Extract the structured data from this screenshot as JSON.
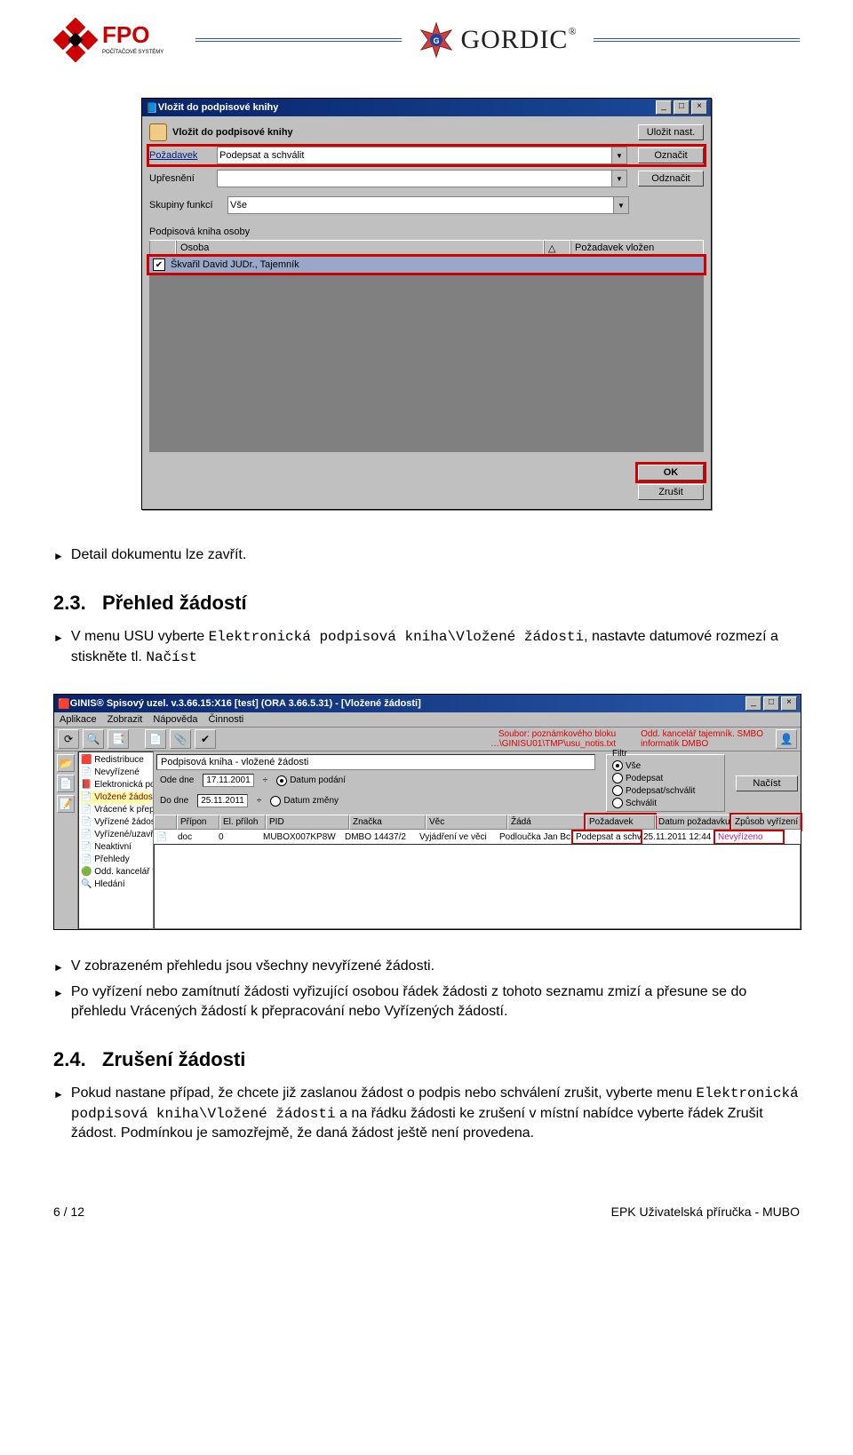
{
  "header": {
    "fpo_sub": "POČÍTAČOVÉ SYSTÉMY",
    "gordic": "GORDIC",
    "reg": "®"
  },
  "dialog1": {
    "title": "Vložit do podpisové knihy",
    "heading": "Vložit do podpisové knihy",
    "btn_save": "Uložit nast.",
    "btn_mark": "Označit",
    "btn_unmark": "Odznačit",
    "lbl_request": "Požadavek",
    "val_request": "Podepsat a schválit",
    "lbl_refine": "Upřesnění",
    "lbl_groups": "Skupiny funkcí",
    "val_groups": "Vše",
    "lbl_book": "Podpisová kniha osoby",
    "col_osoba": "Osoba",
    "col_req": "Požadavek vložen",
    "row_person": "Škvařil David JUDr., Tajemník",
    "btn_ok": "OK",
    "btn_cancel": "Zrušit"
  },
  "text1": "Detail dokumentu lze zavřít.",
  "sec23": {
    "num": "2.3.",
    "title": "Přehled žádostí",
    "p1a": "V menu USU vyberte ",
    "p1b": "Elektronická podpisová kniha\\Vložené žádosti",
    "p1c": ", nastavte datumové rozmezí a stiskněte tl. ",
    "p1d": "Načíst"
  },
  "app": {
    "title": "GINIS® Spisový uzel. v.3.66.15:X16 [test] (ORA 3.66.5.31) - [Vložené žádosti]",
    "menu": [
      "Aplikace",
      "Zobrazit",
      "Nápověda",
      "Činnosti"
    ],
    "red_top1": "Soubor: poznámkového bloku",
    "red_top2": "…\\GINISU01\\TMP\\usu_notis.txt",
    "red_right1": "Odd. kancelář tajemník. SMBO",
    "red_right2": "informatik              DMBO",
    "tree": {
      "i0": "🟥 Redistribuce",
      "i1": "📄 Nevyřízené",
      "i2": "📕 Elektronická podpisová kniha",
      "i3": "   📄 Vložené žádosti",
      "i4": "   📄 Vrácené k přepracování",
      "i5": "   📄 Vyřízené žádosti",
      "i6": "📄 Vyřízené/uzavřené",
      "i7": "📄 Neaktivní",
      "i8": "📄 Přehledy",
      "i9": "🟢 Odd. kancelář tajemníka",
      "i10": "🔍 Hledání"
    },
    "pane_title": "Podpisová kniha - vložené žádosti",
    "lbl_from": "Ode dne",
    "val_from": "17.11.2001",
    "lbl_to": "Do dne",
    "val_to": "25.11.2011",
    "r_podani": "Datum podání",
    "r_zmeny": "Datum změny",
    "grp_filter": "Filtr",
    "r_vse": "Vše",
    "r_podepsat": "Podepsat",
    "r_podschval": "Podepsat/schválit",
    "r_schvalit": "Schválit",
    "btn_load": "Načíst",
    "cols": [
      "Přípon",
      "El. příloh",
      "PID",
      "Značka",
      "Věc",
      "Žádá",
      "Požadavek",
      "Datum požadavku",
      "Způsob vyřízení"
    ],
    "row": {
      "pripon": "doc",
      "el": "0",
      "pid": "MUBOX007KP8W",
      "znacka": "DMBO  14437/2",
      "vec": "Vyjádření ve věci",
      "zada": "Podloučka Jan Bc..",
      "poz": "Podepsat a schválit",
      "datum": "25.11.2011 12:44",
      "vyr": "Nevyřízeno"
    }
  },
  "after_app": {
    "b1": "V zobrazeném přehledu jsou všechny nevyřízené žádosti.",
    "b2": "Po vyřízení nebo zamítnutí žádosti vyřizující osobou řádek žádosti z tohoto seznamu zmizí a přesune se do přehledu Vrácených žádostí k přepracování nebo Vyřízených žádostí."
  },
  "sec24": {
    "num": "2.4.",
    "title": "Zrušení žádosti",
    "p1a": "Pokud nastane případ, že chcete již zaslanou žádost o podpis nebo schválení zrušit, vyberte menu ",
    "p1b": "Elektronická podpisová kniha\\Vložené žádosti",
    "p1c": " a na řádku žádosti ke zrušení v místní nabídce vyberte řádek Zrušit žádost. Podmínkou je samozřejmě, že daná žádost ještě není provedena."
  },
  "footer": {
    "left": "6 / 12",
    "right": "EPK Uživatelská příručka - MUBO"
  }
}
